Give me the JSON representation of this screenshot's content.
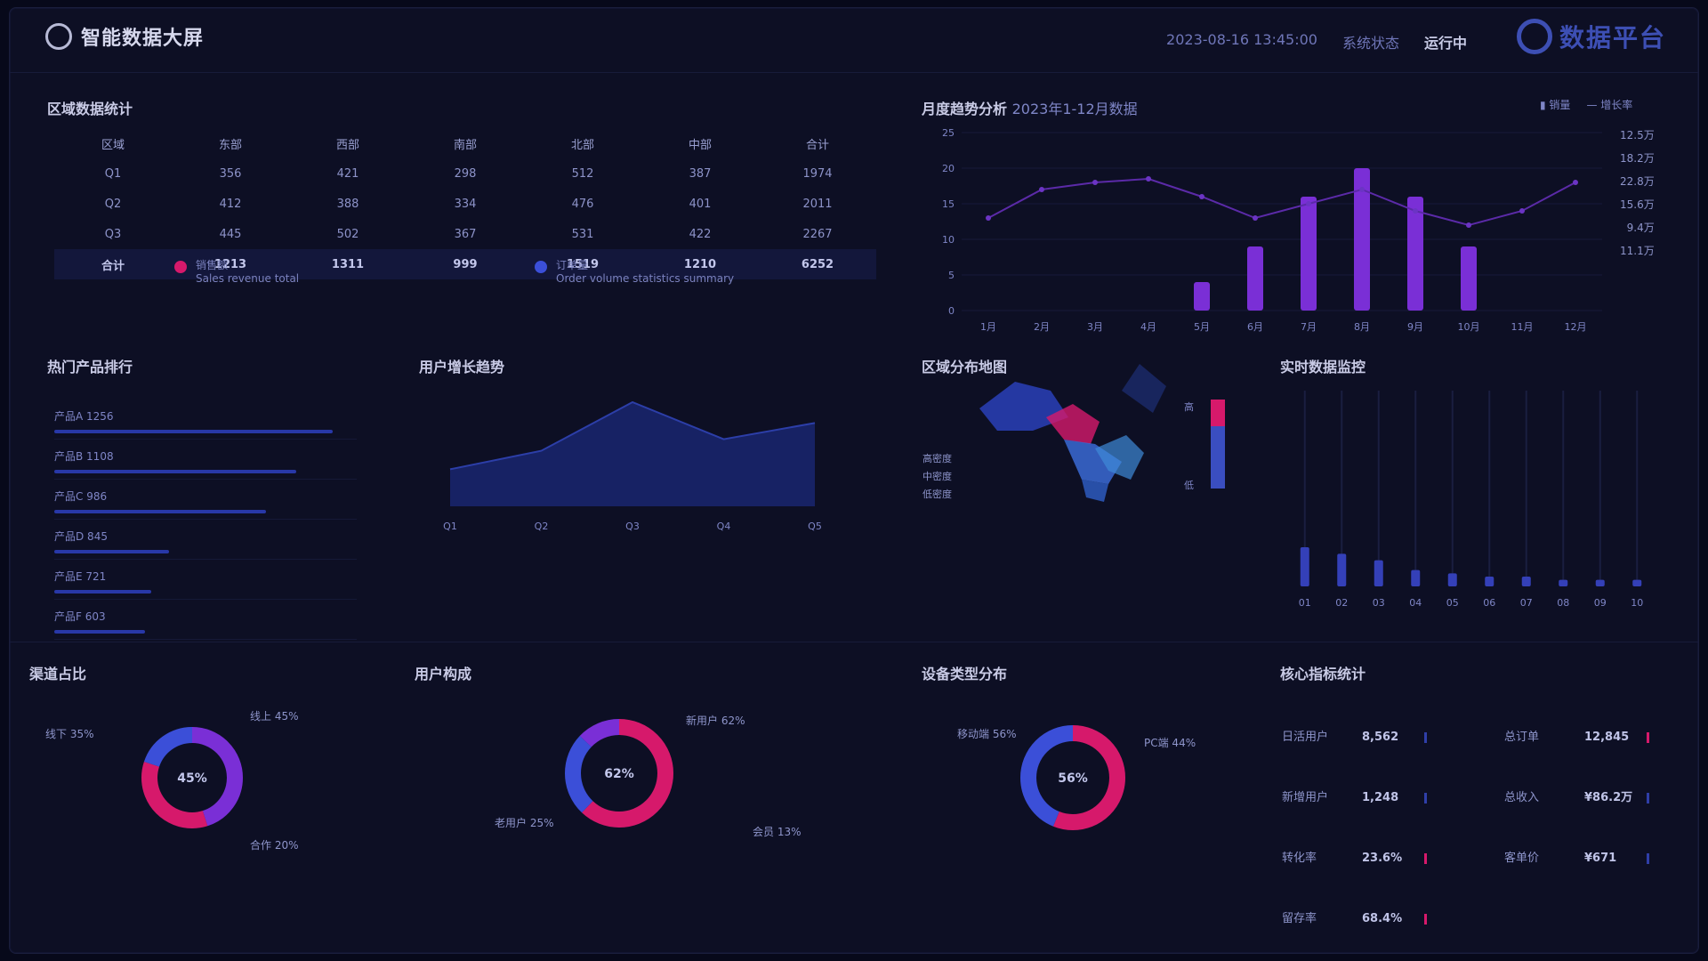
{
  "header": {
    "title": "智能数据大屏",
    "datetime": "2023-08-16 13:45:00",
    "status_label": "系统状态",
    "status_value": "运行中",
    "brand": "数据平台"
  },
  "table_panel": {
    "title": "区域数据统计",
    "columns": [
      "区域",
      "东部",
      "西部",
      "南部",
      "北部",
      "中部",
      "合计"
    ],
    "rows": [
      [
        "Q1",
        "356",
        "421",
        "298",
        "512",
        "387",
        "1974"
      ],
      [
        "Q2",
        "412",
        "388",
        "334",
        "476",
        "401",
        "2011"
      ],
      [
        "Q3",
        "445",
        "502",
        "367",
        "531",
        "422",
        "2267"
      ],
      [
        "合计",
        "1213",
        "1311",
        "999",
        "1519",
        "1210",
        "6252"
      ]
    ],
    "legend": [
      {
        "name": "销售额",
        "desc": "Sales revenue total",
        "color": "#d6196b"
      },
      {
        "name": "订单量",
        "desc": "Order volume statistics summary",
        "color": "#3b4fd8"
      }
    ]
  },
  "combo_panel": {
    "title": "月度趋势分析",
    "subtitle": "2023年1-12月数据",
    "legend": [
      "销量",
      "增长率"
    ],
    "right_list": [
      "12.5万",
      "18.2万",
      "22.8万",
      "15.6万",
      "9.4万",
      "11.1万"
    ]
  },
  "rank_panel": {
    "title": "热门产品排行",
    "items": [
      {
        "label": "产品A 1256",
        "value": 0.92
      },
      {
        "label": "产品B 1108",
        "value": 0.8
      },
      {
        "label": "产品C 986",
        "value": 0.7
      },
      {
        "label": "产品D 845",
        "value": 0.38
      },
      {
        "label": "产品E 721",
        "value": 0.32
      },
      {
        "label": "产品F 603",
        "value": 0.3
      }
    ]
  },
  "line_panel": {
    "title": "用户增长趋势"
  },
  "map_panel": {
    "title": "区域分布地图",
    "legend": [
      "高密度",
      "中密度",
      "低密度"
    ],
    "scale_high": "高",
    "scale_low": "低"
  },
  "vbar_panel": {
    "title": "实时数据监控"
  },
  "donut1": {
    "title": "渠道占比"
  },
  "donut2": {
    "title": "用户构成"
  },
  "donut3": {
    "title": "设备类型分布"
  },
  "kv_panel": {
    "title": "核心指标统计",
    "left": [
      {
        "k": "日活用户",
        "v": "8,562",
        "c": "#2f3ea8"
      },
      {
        "k": "新增用户",
        "v": "1,248",
        "c": "#2f3ea8"
      },
      {
        "k": "转化率",
        "v": "23.6%",
        "c": "#d6196b"
      },
      {
        "k": "留存率",
        "v": "68.4%",
        "c": "#d6196b"
      }
    ],
    "right": [
      {
        "k": "总订单",
        "v": "12,845",
        "c": "#d6196b"
      },
      {
        "k": "总收入",
        "v": "¥86.2万",
        "c": "#2f3ea8"
      },
      {
        "k": "客单价",
        "v": "¥671",
        "c": "#2f3ea8"
      }
    ]
  },
  "chart_data": [
    {
      "type": "bar",
      "title": "月度趋势分析",
      "categories": [
        "1月",
        "2月",
        "3月",
        "4月",
        "5月",
        "6月",
        "7月",
        "8月",
        "9月",
        "10月",
        "11月",
        "12月"
      ],
      "series": [
        {
          "name": "销量",
          "values": [
            0,
            0,
            0,
            0,
            4,
            9,
            16,
            20,
            16,
            9,
            0,
            0
          ]
        },
        {
          "name": "增长率",
          "values": [
            13,
            17,
            18,
            18.5,
            16,
            13,
            15,
            17,
            14,
            12,
            14,
            18
          ]
        }
      ],
      "ylim": [
        0,
        25
      ]
    },
    {
      "type": "area",
      "title": "用户增长趋势",
      "categories": [
        "Q1",
        "Q2",
        "Q3",
        "Q4",
        "Q5"
      ],
      "values": [
        32,
        48,
        90,
        58,
        72
      ],
      "ylim": [
        0,
        100
      ]
    },
    {
      "type": "bar",
      "title": "实时数据监控",
      "categories": [
        "01",
        "02",
        "03",
        "04",
        "05",
        "06",
        "07",
        "08",
        "09",
        "10"
      ],
      "values": [
        12,
        10,
        8,
        5,
        4,
        3,
        3,
        2,
        2,
        2
      ],
      "ylim": [
        0,
        60
      ]
    },
    {
      "type": "pie",
      "title": "渠道占比",
      "categories": [
        "线上",
        "线下",
        "合作"
      ],
      "values": [
        45,
        35,
        20
      ],
      "center": "45%"
    },
    {
      "type": "pie",
      "title": "用户构成",
      "categories": [
        "新用户",
        "老用户",
        "会员"
      ],
      "values": [
        62,
        25,
        13
      ],
      "center": "62%"
    },
    {
      "type": "pie",
      "title": "设备类型分布",
      "categories": [
        "移动端",
        "PC端"
      ],
      "values": [
        56,
        44
      ],
      "center": "56%"
    }
  ]
}
